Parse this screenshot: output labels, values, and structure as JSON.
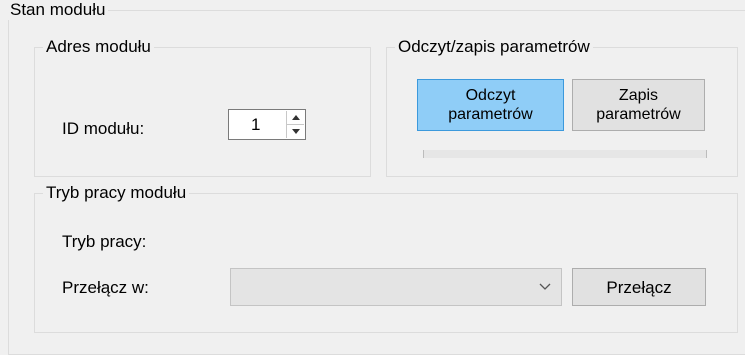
{
  "stan_group": {
    "title": "Stan modułu"
  },
  "adres_group": {
    "title": "Adres modułu",
    "id_label": "ID modułu:",
    "id_value": "1"
  },
  "odczyt_group": {
    "title": "Odczyt/zapis parametrów",
    "read_line1": "Odczyt",
    "read_line2": "parametrów",
    "write_line1": "Zapis",
    "write_line2": "parametrów",
    "progress": 0
  },
  "tryb_group": {
    "title": "Tryb pracy modułu",
    "mode_label": "Tryb pracy:",
    "mode_value": "",
    "switch_label": "Przełącz w:",
    "switch_selected": "",
    "switch_button": "Przełącz"
  }
}
